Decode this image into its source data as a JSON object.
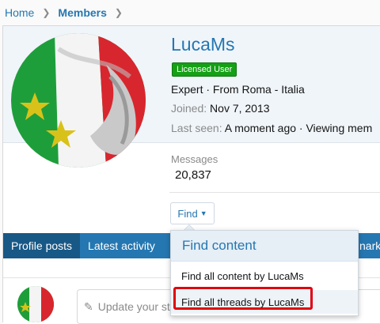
{
  "breadcrumb": {
    "home": "Home",
    "members": "Members"
  },
  "profile": {
    "name": "LucaMs",
    "badge": "Licensed User",
    "title_line": "Expert · From Roma - Italia",
    "joined_label": "Joined:",
    "joined_value": "Nov 7, 2013",
    "last_seen_label": "Last seen:",
    "last_seen_value": "A moment ago · Viewing mem",
    "messages_label": "Messages",
    "messages_value": "20,837",
    "find_label": "Find"
  },
  "tabs": [
    "Profile posts",
    "Latest activity"
  ],
  "tab_overflow": "narks",
  "post_placeholder": "Update your st",
  "find_menu": {
    "title": "Find content",
    "items": [
      "Find all content by LucaMs",
      "Find all threads by LucaMs"
    ]
  },
  "colors": {
    "accent": "#2577b1",
    "badge": "#15a015",
    "highlight": "#e00010"
  }
}
